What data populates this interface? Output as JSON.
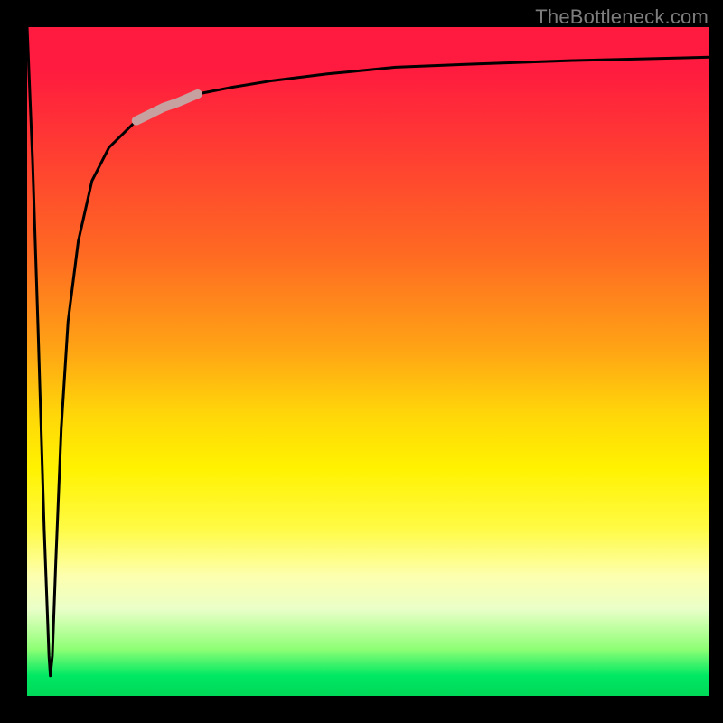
{
  "watermark": "TheBottleneck.com",
  "chart_data": {
    "type": "line",
    "title": "",
    "xlabel": "",
    "ylabel": "",
    "xlim": [
      0,
      100
    ],
    "ylim": [
      0,
      100
    ],
    "background_gradient": [
      "#ff1a3f",
      "#ff6a22",
      "#ffd709",
      "#fff200",
      "#00d858"
    ],
    "series": [
      {
        "name": "bottleneck-curve",
        "color": "#000000",
        "x": [
          0,
          0.8,
          1.6,
          2.5,
          3.2,
          3.4,
          3.7,
          4.2,
          5.0,
          6.0,
          7.5,
          9.5,
          12,
          16,
          20,
          25,
          30,
          36,
          44,
          54,
          66,
          80,
          100
        ],
        "values": [
          100,
          80,
          55,
          25,
          6,
          3,
          6,
          20,
          40,
          56,
          68,
          77,
          82,
          86,
          88,
          90,
          91,
          92,
          93,
          94,
          94.5,
          95,
          95.5
        ]
      },
      {
        "name": "highlight-segment",
        "color": "#c7a0a0",
        "x": [
          16,
          18,
          20,
          22,
          25
        ],
        "values": [
          86,
          87,
          88,
          88.7,
          90
        ]
      }
    ]
  }
}
